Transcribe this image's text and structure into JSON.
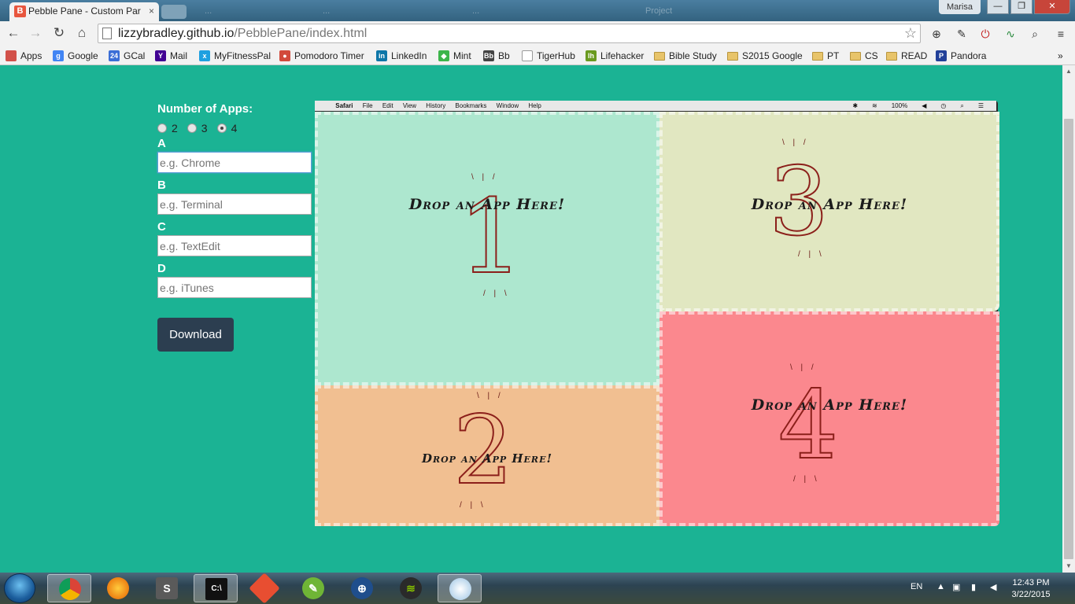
{
  "browser": {
    "tab_title": "Pebble Pane - Custom Par",
    "tab_favicon": "B",
    "tab_close": "×",
    "ghost_tabs": [
      "...",
      "...",
      "...",
      "Project"
    ],
    "user": "Marisa",
    "window_buttons": {
      "minimize": "—",
      "maximize": "❐",
      "close": "✕"
    },
    "url_host": "lizzybradley.github.io",
    "url_path": "/PebblePane/index.html",
    "bookmarks": [
      {
        "label": "Apps",
        "color": "#d2514a"
      },
      {
        "label": "Google",
        "color": "#4285f4",
        "glyph": "g"
      },
      {
        "label": "GCal",
        "color": "#3b6ed6",
        "glyph": "24"
      },
      {
        "label": "Mail",
        "color": "#410093",
        "glyph": "Y"
      },
      {
        "label": "MyFitnessPal",
        "color": "#1ea0e0",
        "glyph": "x"
      },
      {
        "label": "Pomodoro Timer",
        "color": "#d24a3c",
        "glyph": "●"
      },
      {
        "label": "LinkedIn",
        "color": "#0e76a8",
        "glyph": "in"
      },
      {
        "label": "Mint",
        "color": "#3cb54a",
        "glyph": "◆"
      },
      {
        "label": "Bb",
        "color": "#444",
        "glyph": "Bb"
      },
      {
        "label": "TigerHub",
        "color": "#ffffff",
        "glyph": ""
      },
      {
        "label": "Lifehacker",
        "color": "#6a9a1f",
        "glyph": "lh"
      },
      {
        "label": "Bible Study",
        "folder": true
      },
      {
        "label": "S2015 Google",
        "folder": true
      },
      {
        "label": "PT",
        "folder": true
      },
      {
        "label": "CS",
        "folder": true
      },
      {
        "label": "READ",
        "folder": true
      },
      {
        "label": "Pandora",
        "color": "#224099",
        "glyph": "P"
      }
    ],
    "bookmarks_more": "»"
  },
  "form": {
    "num_apps_label": "Number of Apps:",
    "options": [
      "2",
      "3",
      "4"
    ],
    "selected": "4",
    "fields": [
      {
        "label": "A",
        "placeholder": "e.g. Chrome"
      },
      {
        "label": "B",
        "placeholder": "e.g. Terminal"
      },
      {
        "label": "C",
        "placeholder": "e.g. TextEdit"
      },
      {
        "label": "D",
        "placeholder": "e.g. iTunes"
      }
    ],
    "download_label": "Download"
  },
  "mac_menubar": {
    "apple": "",
    "app": "Safari",
    "menus": [
      "File",
      "Edit",
      "View",
      "History",
      "Bookmarks",
      "Window",
      "Help"
    ],
    "battery": "100%"
  },
  "panes": [
    {
      "id": "1",
      "digit": "1",
      "text": "Drop an App Here!",
      "color": "#ade7cf"
    },
    {
      "id": "2",
      "digit": "2",
      "text": "Drop an App Here!",
      "color": "#f1bf91"
    },
    {
      "id": "3",
      "digit": "3",
      "text": "Drop an App Here!",
      "color": "#e1e7c1"
    },
    {
      "id": "4",
      "digit": "4",
      "text": "Drop an App Here!",
      "color": "#fb888e"
    }
  ],
  "taskbar": {
    "language": "EN",
    "time": "12:43 PM",
    "date": "3/22/2015"
  }
}
